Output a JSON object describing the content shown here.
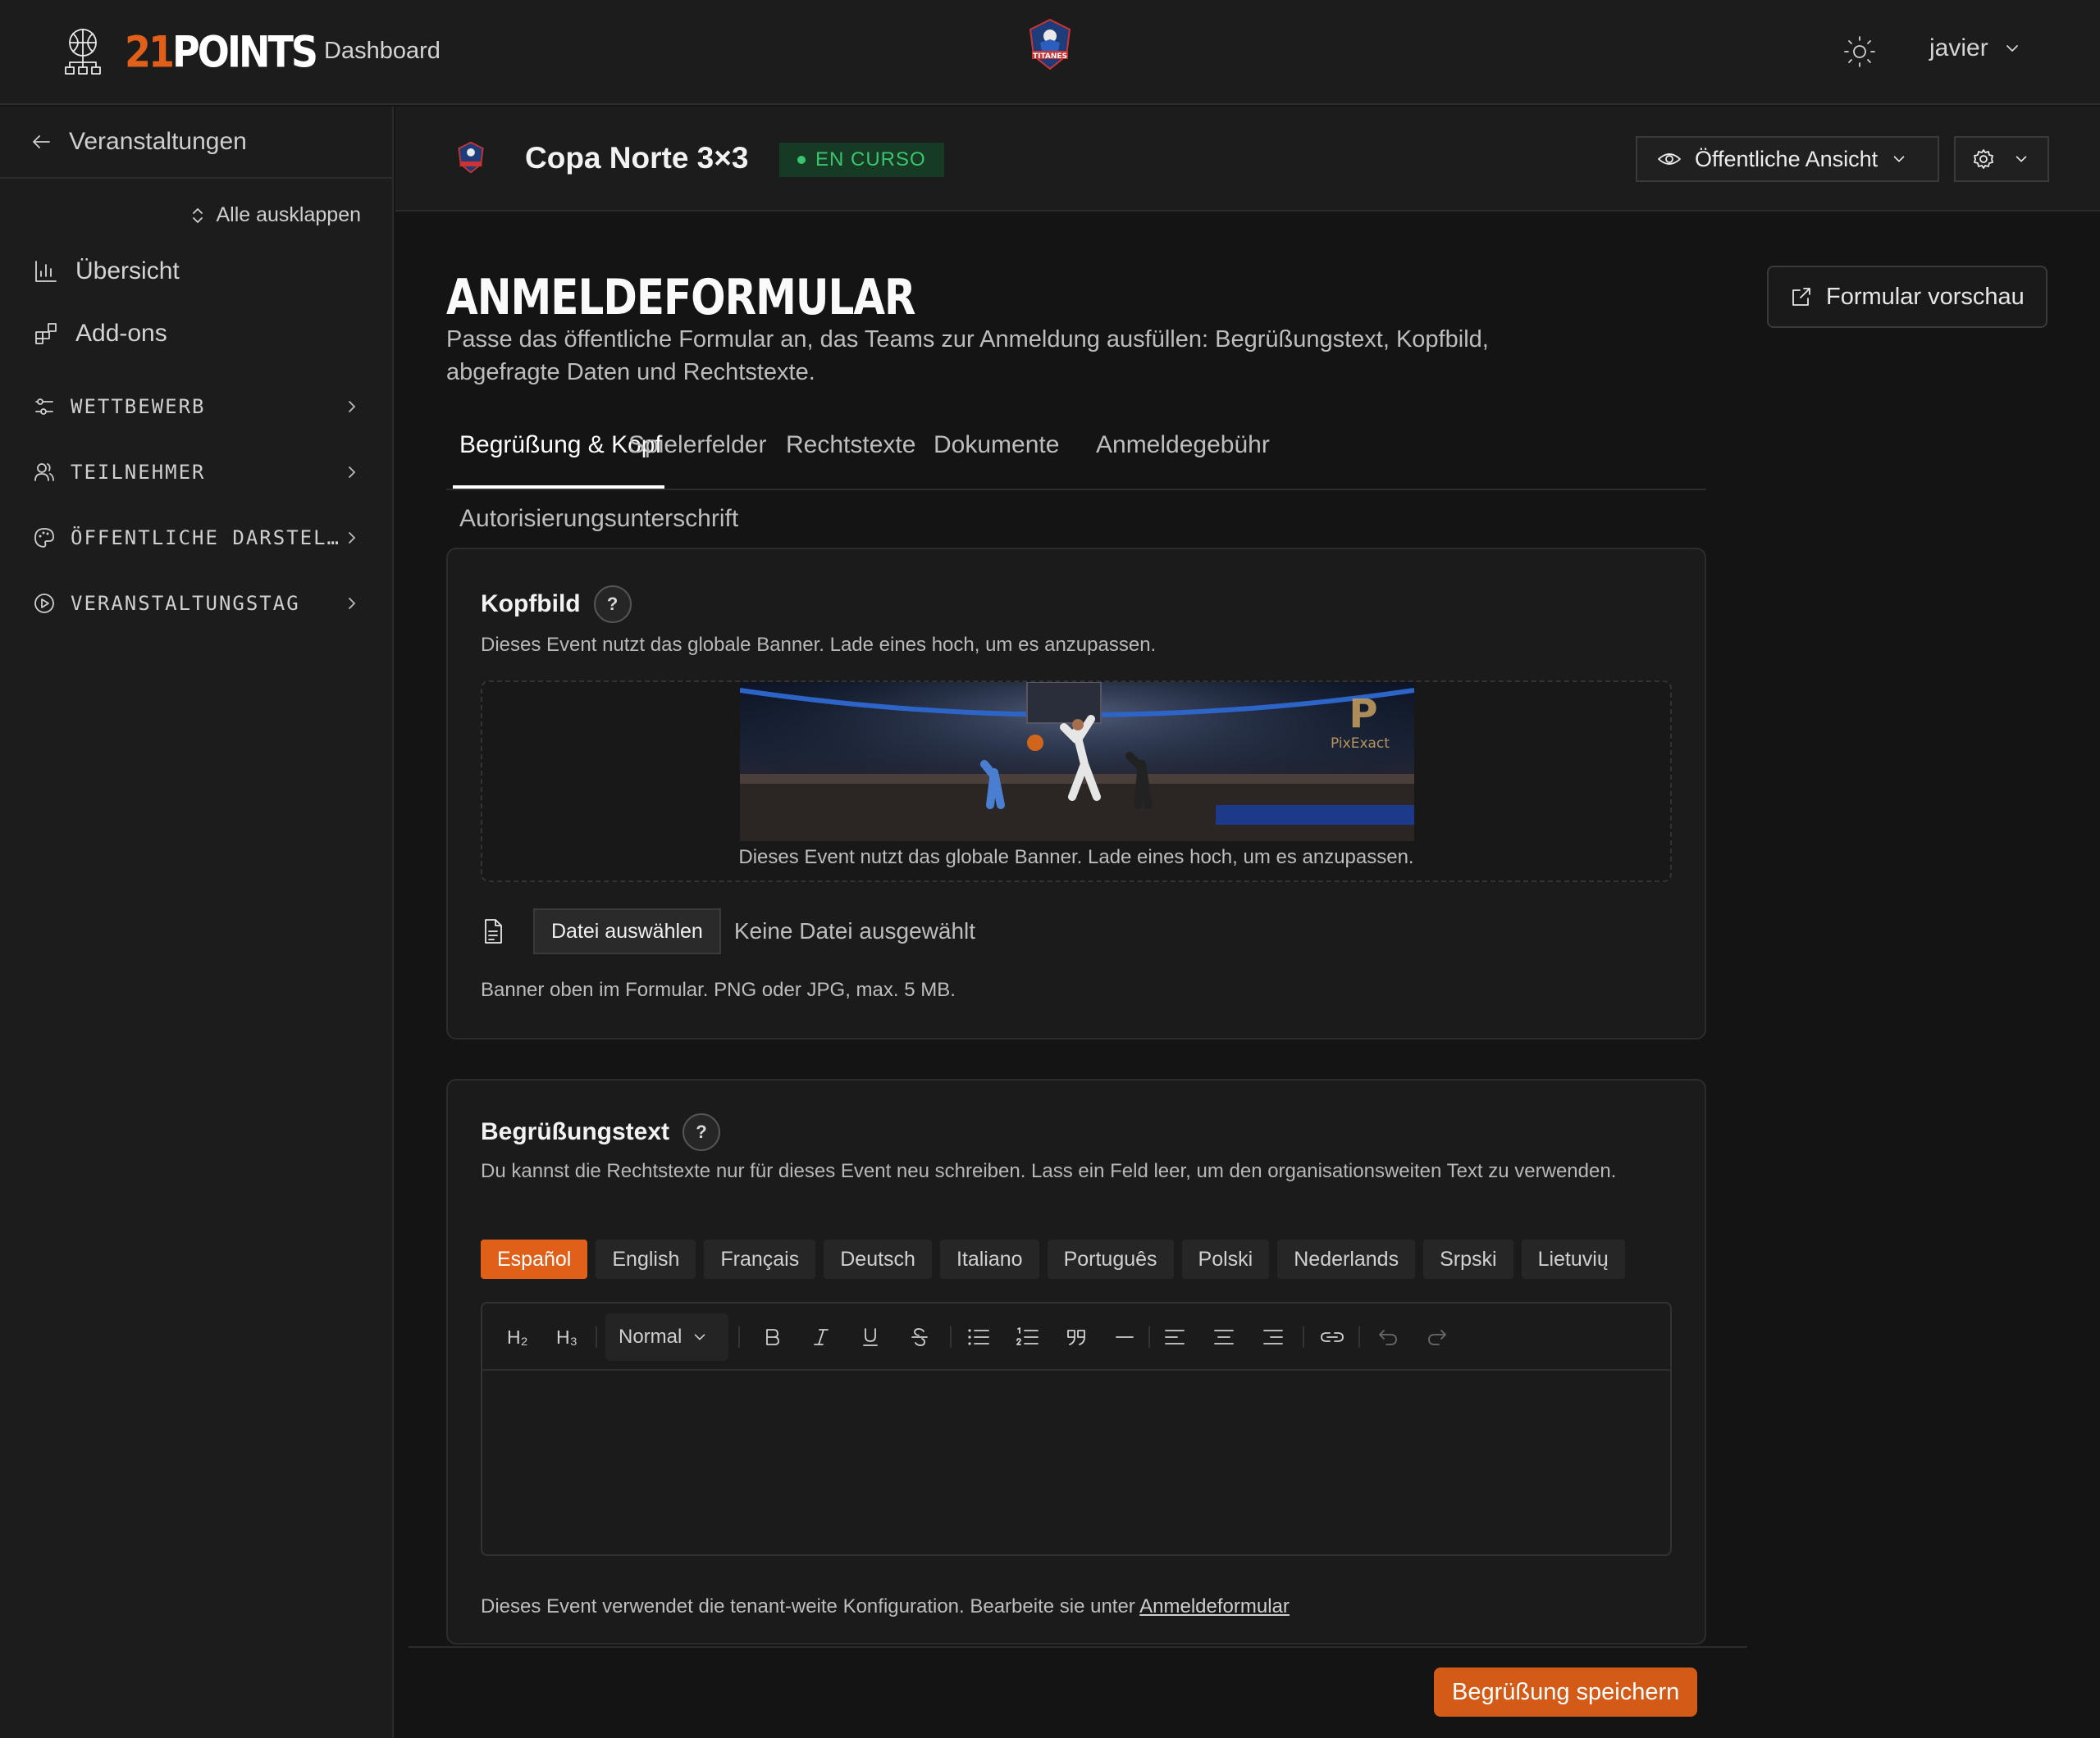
{
  "topbar": {
    "brand_number": "21",
    "brand_word": "POINTS",
    "dashboard_label": "Dashboard",
    "center_logo_icon": "titanes-logo-icon",
    "theme_icon": "sun-icon",
    "user_name": "javier"
  },
  "sidebar": {
    "back_label": "Veranstaltungen",
    "expand_all_label": "Alle ausklappen",
    "items": [
      {
        "label": "Übersicht",
        "icon": "bar-chart-icon"
      },
      {
        "label": "Add-ons",
        "icon": "add-ons-icon"
      }
    ],
    "sections": [
      {
        "label": "WETTBEWERB",
        "icon": "sliders-icon"
      },
      {
        "label": "TEILNEHMER",
        "icon": "users-icon"
      },
      {
        "label": "ÖFFENTLICHE DARSTEL…",
        "icon": "palette-icon"
      },
      {
        "label": "VERANSTALTUNGSTAG",
        "icon": "play-circle-icon"
      }
    ]
  },
  "event": {
    "title": "Copa Norte 3×3",
    "status": "EN CURSO",
    "public_view_label": "Öffentliche Ansicht",
    "settings_icon": "gear-icon"
  },
  "page": {
    "title": "ANMELDEFORMULAR",
    "description": "Passe das öffentliche Formular an, das Teams zur Anmeldung ausfüllen: Begrüßungstext, Kopfbild, abgefragte Daten und Rechtstexte.",
    "preview_label": "Formular vorschau",
    "tabs": [
      "Begrüßung & Kopf",
      "Spielerfelder",
      "Rechtstexte",
      "Dokumente",
      "Anmeldegebühr",
      "Autorisierungsunterschrift"
    ],
    "active_tab": "Begrüßung & Kopf"
  },
  "header_image": {
    "title": "Kopfbild",
    "help": "?",
    "subtitle": "Dieses Event nutzt das globale Banner. Lade eines hoch, um es anzupassen.",
    "banner_caption": "Dieses Event nutzt das globale Banner. Lade eines hoch, um es anzupassen.",
    "banner_watermark": "PixExact",
    "choose_file_label": "Datei auswählen",
    "no_file_label": "Keine Datei ausgewählt",
    "help_text": "Banner oben im Formular. PNG oder JPG, max. 5 MB."
  },
  "welcome": {
    "title": "Begrüßungstext",
    "help": "?",
    "subtitle": "Du kannst die Rechtstexte nur für dieses Event neu schreiben. Lass ein Feld leer, um den organisationsweiten Text zu verwenden.",
    "languages": [
      "Español",
      "English",
      "Français",
      "Deutsch",
      "Italiano",
      "Português",
      "Polski",
      "Nederlands",
      "Srpski",
      "Lietuvių"
    ],
    "active_language": "Español",
    "toolbar": {
      "h2": "H₂",
      "h3": "H₃",
      "block_style": "Normal"
    },
    "editor_content": "",
    "footer_text": "Dieses Event verwendet die tenant-weite Konfiguration. Bearbeite sie unter",
    "footer_link": "Anmeldeformular",
    "save_label": "Begrüßung speichern"
  },
  "colors": {
    "accent": "#e0601a",
    "status_green": "#3bc46e",
    "background": "#141414",
    "panel": "#1c1c1c"
  }
}
